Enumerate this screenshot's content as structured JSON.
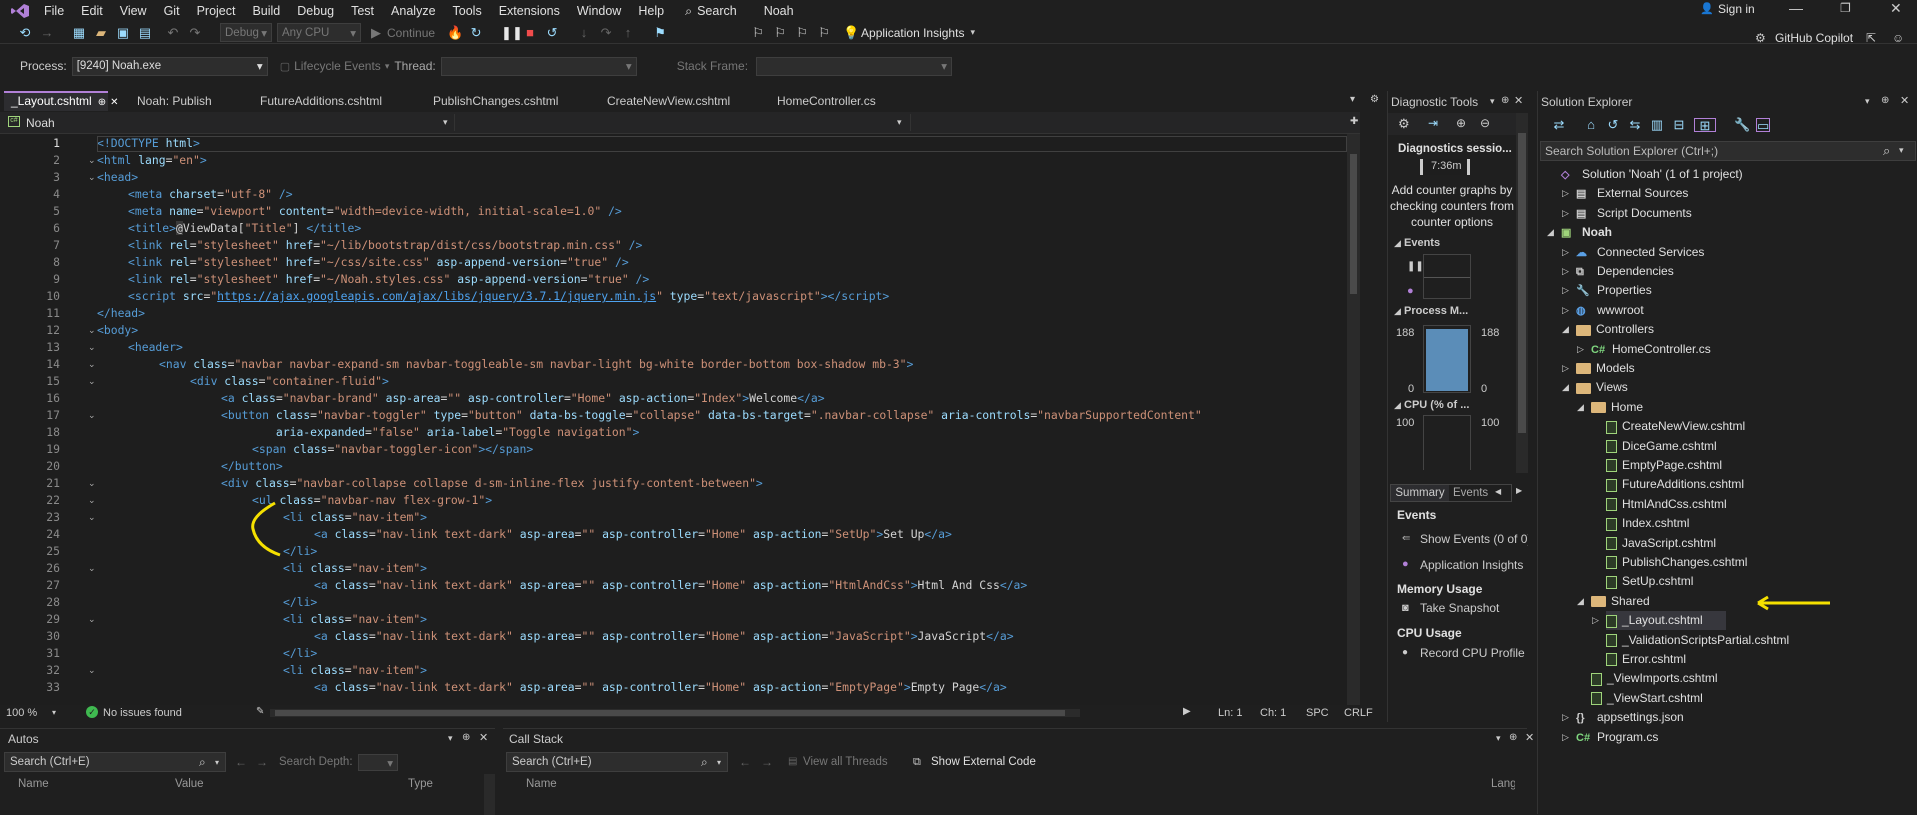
{
  "menu": {
    "items": [
      "File",
      "Edit",
      "View",
      "Git",
      "Project",
      "Build",
      "Debug",
      "Test",
      "Analyze",
      "Tools",
      "Extensions",
      "Window",
      "Help"
    ],
    "search": "Search",
    "app_name": "Noah",
    "sign_in": "Sign in"
  },
  "toolbar": {
    "config": "Debug",
    "platform": "Any CPU",
    "continue": "Continue",
    "app_insights": "Application Insights",
    "copilot": "GitHub Copilot"
  },
  "debug_bar": {
    "process_label": "Process:",
    "process_value": "[9240] Noah.exe",
    "lifecycle": "Lifecycle Events",
    "thread_label": "Thread:",
    "stack_frame_label": "Stack Frame:"
  },
  "editor": {
    "tabs": [
      "_Layout.cshtml",
      "Noah: Publish",
      "FutureAdditions.cshtml",
      "PublishChanges.cshtml",
      "CreateNewView.cshtml",
      "HomeController.cs"
    ],
    "project_dropdown": "Noah",
    "zoom": "100 %",
    "issues": "No issues found",
    "ln": "Ln: 1",
    "ch": "Ch: 1",
    "spc": "SPC",
    "crlf": "CRLF",
    "lines": [
      "1",
      "2",
      "3",
      "4",
      "5",
      "6",
      "7",
      "8",
      "9",
      "10",
      "11",
      "12",
      "13",
      "14",
      "15",
      "16",
      "17",
      "18",
      "19",
      "20",
      "21",
      "22",
      "23",
      "24",
      "25",
      "26",
      "27",
      "28",
      "29",
      "30",
      "31",
      "32",
      "33"
    ]
  },
  "diagnostic": {
    "title": "Diagnostic Tools",
    "session": "Diagnostics sessio...",
    "time": "7:36m",
    "hint": "Add counter graphs by checking counters from counter options",
    "events": "Events",
    "process_memory": "Process M...",
    "mem_max_left": "188",
    "mem_max_right": "188",
    "mem_min_left": "0",
    "mem_min_right": "0",
    "cpu": "CPU (% of ...",
    "cpu_max_left": "100",
    "cpu_max_right": "100",
    "tab_summary": "Summary",
    "tab_events": "Events",
    "sec_events": "Events",
    "show_events": "Show Events (0 of 0)",
    "app_insights": "Application Insights",
    "sec_memory": "Memory Usage",
    "take_snapshot": "Take Snapshot",
    "sec_cpu": "CPU Usage",
    "record_cpu": "Record CPU Profile"
  },
  "solution_explorer": {
    "title": "Solution Explorer",
    "search_placeholder": "Search Solution Explorer (Ctrl+;)",
    "items": [
      {
        "label": "Solution 'Noah' (1 of 1 project)",
        "type": "solution"
      },
      {
        "label": "External Sources",
        "type": "ext"
      },
      {
        "label": "Script Documents",
        "type": "ext"
      },
      {
        "label": "Noah",
        "type": "project"
      },
      {
        "label": "Connected Services",
        "type": "svc"
      },
      {
        "label": "Dependencies",
        "type": "dep"
      },
      {
        "label": "Properties",
        "type": "prop"
      },
      {
        "label": "wwwroot",
        "type": "globe"
      },
      {
        "label": "Controllers",
        "type": "folder"
      },
      {
        "label": "HomeController.cs",
        "type": "cs"
      },
      {
        "label": "Models",
        "type": "folder"
      },
      {
        "label": "Views",
        "type": "folder"
      },
      {
        "label": "Home",
        "type": "folder"
      },
      {
        "label": "CreateNewView.cshtml",
        "type": "file"
      },
      {
        "label": "DiceGame.cshtml",
        "type": "file"
      },
      {
        "label": "EmptyPage.cshtml",
        "type": "file"
      },
      {
        "label": "FutureAdditions.cshtml",
        "type": "file"
      },
      {
        "label": "HtmlAndCss.cshtml",
        "type": "file"
      },
      {
        "label": "Index.cshtml",
        "type": "file"
      },
      {
        "label": "JavaScript.cshtml",
        "type": "file"
      },
      {
        "label": "PublishChanges.cshtml",
        "type": "file"
      },
      {
        "label": "SetUp.cshtml",
        "type": "file"
      },
      {
        "label": "Shared",
        "type": "folder"
      },
      {
        "label": "_Layout.cshtml",
        "type": "file"
      },
      {
        "label": "_ValidationScriptsPartial.cshtml",
        "type": "file"
      },
      {
        "label": "Error.cshtml",
        "type": "file"
      },
      {
        "label": "_ViewImports.cshtml",
        "type": "file"
      },
      {
        "label": "_ViewStart.cshtml",
        "type": "file"
      },
      {
        "label": "appsettings.json",
        "type": "json"
      },
      {
        "label": "Program.cs",
        "type": "cs"
      }
    ]
  },
  "autos": {
    "title": "Autos",
    "search": "Search (Ctrl+E)",
    "depth": "Search Depth:",
    "col_name": "Name",
    "col_value": "Value",
    "col_type": "Type"
  },
  "callstack": {
    "title": "Call Stack",
    "search": "Search (Ctrl+E)",
    "view_threads": "View all Threads",
    "show_external": "Show External Code",
    "col_name": "Name",
    "col_lang": "Lang"
  },
  "colors": {
    "accent": "#b180d7",
    "annotation": "#f5e000"
  }
}
